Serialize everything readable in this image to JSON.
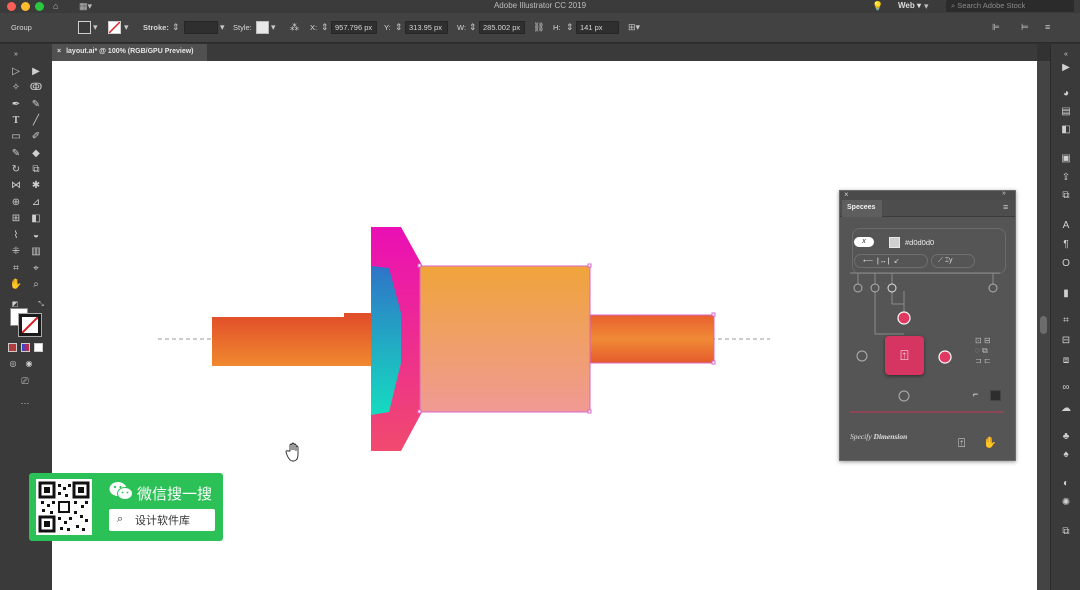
{
  "app": {
    "title": "Adobe Illustrator CC 2019",
    "workspace": "Web",
    "stock_search_placeholder": "Search Adobe Stock"
  },
  "controlbar": {
    "selection_type": "Group",
    "stroke_label": "Stroke:",
    "style_label": "Style:",
    "x_label": "X:",
    "x_value": "957.796 px",
    "y_label": "Y:",
    "y_value": "313.95 px",
    "w_label": "W:",
    "w_value": "285.002 px",
    "h_label": "H:",
    "h_value": "141 px"
  },
  "document": {
    "tab_label": "layout.ai* @ 100% (RGB/GPU Preview)"
  },
  "specees": {
    "panel_title": "Specees",
    "toggle_label": "x",
    "color_hex": "#d0d0d0",
    "footer_italic": "Specify",
    "footer_bold": "Dimension"
  },
  "watermark": {
    "title": "微信搜一搜",
    "search_text": "设计软件库"
  },
  "colors": {
    "accent_pink": "#e8336b",
    "shaft_orange": "#e8552a",
    "body_orange": "#f0a23d"
  }
}
